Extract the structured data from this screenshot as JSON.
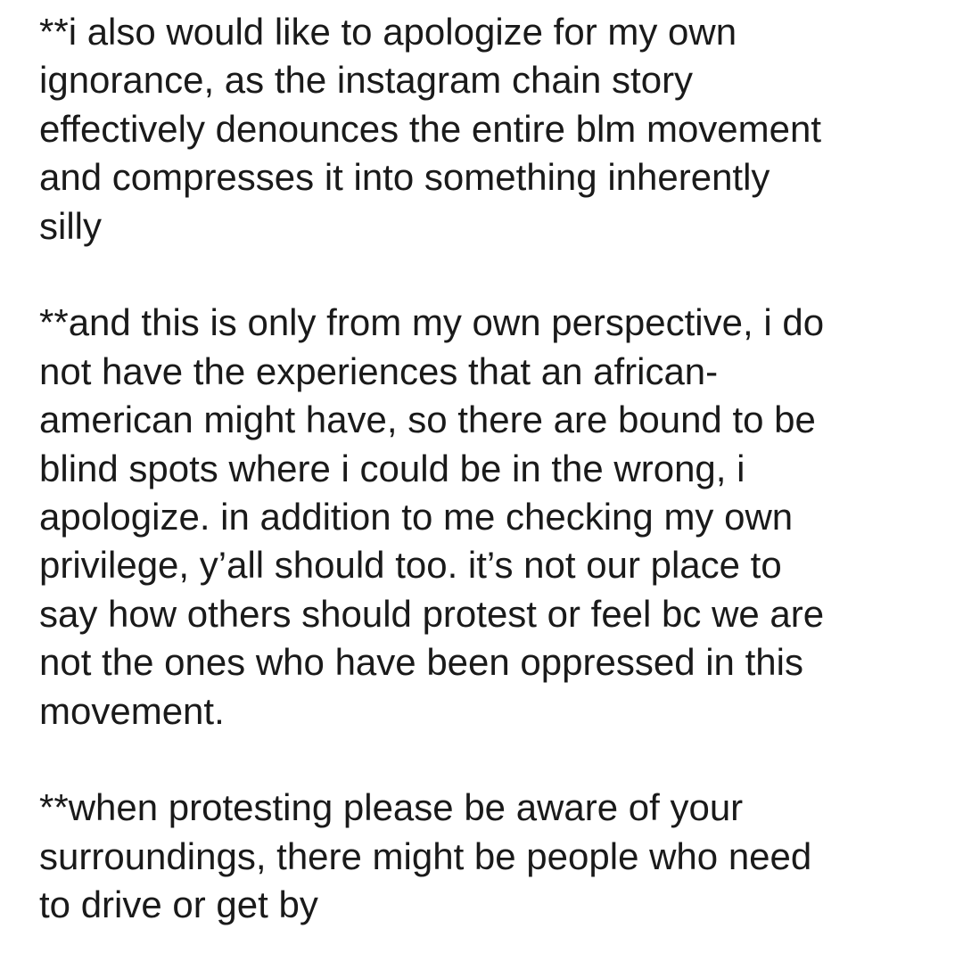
{
  "note": {
    "paragraphs": [
      {
        "lines": [
          "**i also would like to apologize for my own",
          "ignorance, as the instagram chain story",
          "effectively denounces the entire blm movement",
          "and compresses it into something inherently",
          "silly"
        ]
      },
      {
        "lines": [
          "**and this is only from my own perspective, i do",
          "not have the experiences that an african-",
          "american might have, so there are bound to be",
          "blind spots where i could be in the wrong, i",
          "apologize. in addition to me checking my own",
          "privilege, y’all should too. it’s not our place to",
          "say how others should protest or feel bc we are",
          "not the ones who have been oppressed in this",
          "movement."
        ]
      },
      {
        "lines": [
          "**when protesting please be aware of your",
          "surroundings, there might be people who need",
          "to drive or get by"
        ]
      }
    ]
  }
}
